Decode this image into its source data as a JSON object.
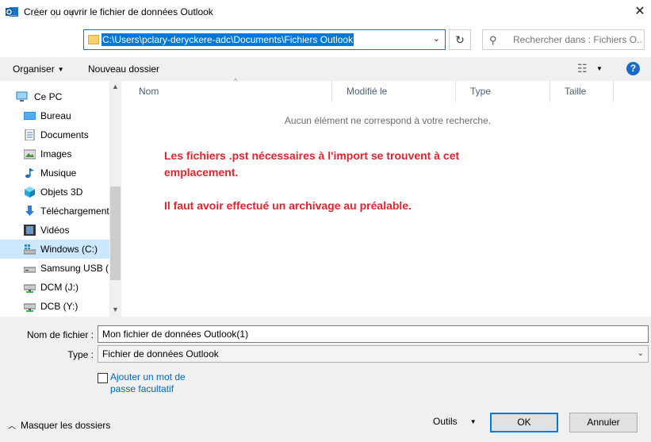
{
  "window": {
    "title": "Créer ou ouvrir le fichier de données Outlook",
    "close": "✕"
  },
  "nav": {
    "back": "←",
    "forward": "→",
    "dropdown": "⌄",
    "up": "↑"
  },
  "address": {
    "path": "C:\\Users\\pclary-deryckere-adc\\Documents\\Fichiers Outlook",
    "chevron": "⌄"
  },
  "refresh_glyph": "↻",
  "search": {
    "placeholder": "Rechercher dans : Fichiers O...",
    "icon": "⚲"
  },
  "toolbar": {
    "organise_label": "Organiser",
    "organise_arrow": "▼",
    "new_folder_label": "Nouveau dossier",
    "view_icon": "☷",
    "view_arrow": "▼",
    "help": "?"
  },
  "sidebar": {
    "items": [
      {
        "label": "Ce PC",
        "icon": "pc-icon"
      },
      {
        "label": "Bureau",
        "icon": "desktop-icon"
      },
      {
        "label": "Documents",
        "icon": "documents-icon"
      },
      {
        "label": "Images",
        "icon": "pictures-icon"
      },
      {
        "label": "Musique",
        "icon": "music-icon"
      },
      {
        "label": "Objets 3D",
        "icon": "objects-3d-icon"
      },
      {
        "label": "Téléchargements",
        "icon": "downloads-icon"
      },
      {
        "label": "Vidéos",
        "icon": "videos-icon"
      },
      {
        "label": "Windows (C:)",
        "icon": "windows-drive-icon",
        "selected": true
      },
      {
        "label": "Samsung USB (D",
        "icon": "usb-drive-icon"
      },
      {
        "label": "DCM (J:)",
        "icon": "network-drive-icon"
      },
      {
        "label": "DCB (Y:)",
        "icon": "network-drive-icon"
      }
    ],
    "scroll_up": "▲",
    "scroll_down": "▼"
  },
  "columns": {
    "name": "Nom",
    "modified": "Modifié le",
    "type": "Type",
    "size": "Taille"
  },
  "sort_indicator": "^",
  "empty_message": "Aucun élément ne correspond à votre recherche.",
  "annotation": {
    "line1": "Les fichiers .pst nécessaires à l'import se trouvent à cet",
    "line2": "emplacement.",
    "line3": "Il faut avoir effectué un archivage au préalable.",
    "color": "#e0242f"
  },
  "form": {
    "filename_label": "Nom de fichier :",
    "filename_value": "Mon fichier de données Outlook(1)",
    "type_label": "Type :",
    "type_value": "Fichier de données Outlook",
    "type_chevron": "⌄",
    "password_line1": "Ajouter un mot de",
    "password_line2": "passe facultatif",
    "hide_folders_label": "Masquer les dossiers",
    "hide_folders_chevron": "︿",
    "tools_label": "Outils",
    "tools_arrow": "▼",
    "ok_label": "OK",
    "cancel_label": "Annuler"
  },
  "colors": {
    "accent": "#0078d7",
    "selection": "#cce8ff",
    "annotation": "#e0242f"
  }
}
